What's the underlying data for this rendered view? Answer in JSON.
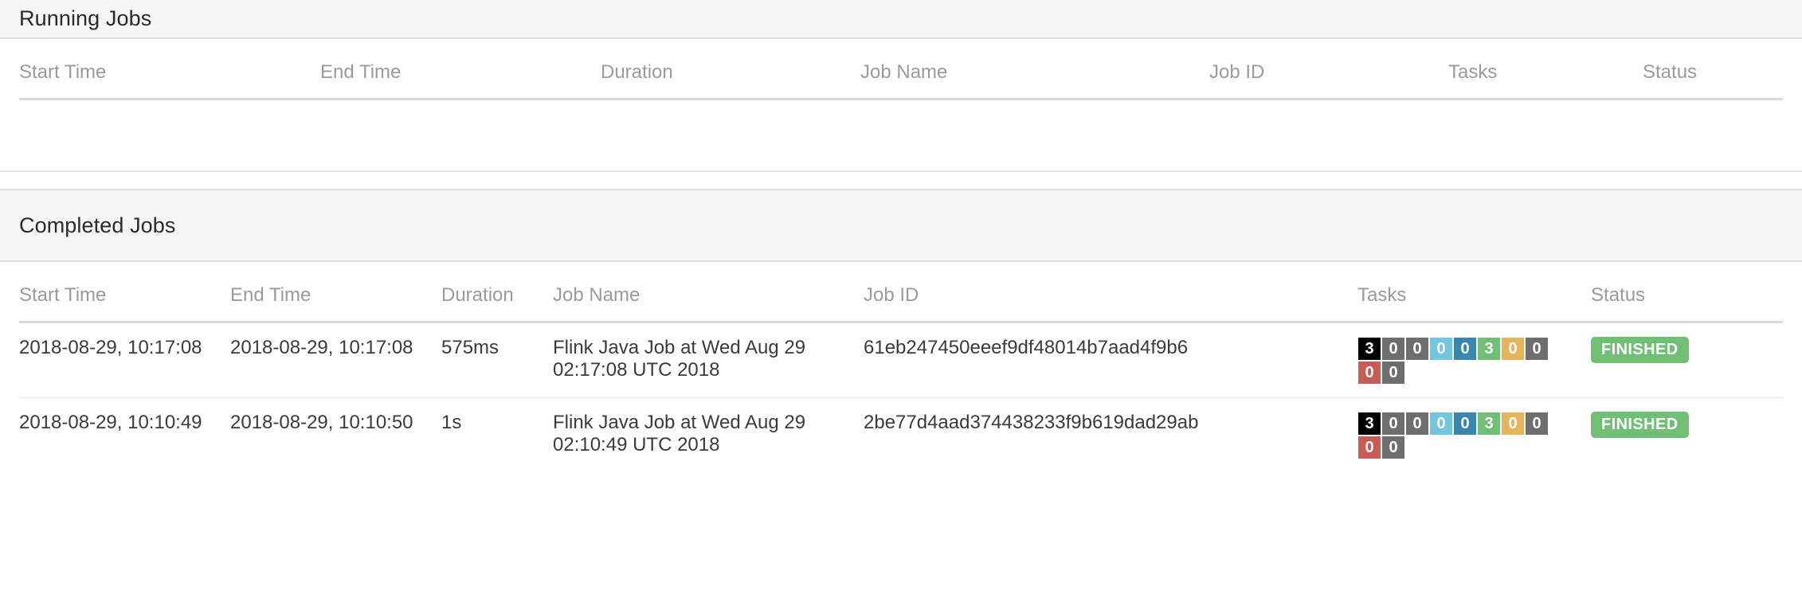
{
  "running": {
    "title": "Running Jobs",
    "columns": [
      "Start Time",
      "End Time",
      "Duration",
      "Job Name",
      "Job ID",
      "Tasks",
      "Status"
    ],
    "rows": []
  },
  "completed": {
    "title": "Completed Jobs",
    "columns": [
      "Start Time",
      "End Time",
      "Duration",
      "Job Name",
      "Job ID",
      "Tasks",
      "Status"
    ],
    "rows": [
      {
        "start_time": "2018-08-29, 10:17:08",
        "end_time": "2018-08-29, 10:17:08",
        "duration": "575ms",
        "job_name": "Flink Java Job at Wed Aug 29 02:17:08 UTC 2018",
        "job_id": "61eb247450eeef9df48014b7aad4f9b6",
        "tasks": [
          {
            "value": "3",
            "color": "#000000",
            "state": "total"
          },
          {
            "value": "0",
            "color": "#6e6e6e",
            "state": "created"
          },
          {
            "value": "0",
            "color": "#6e6e6e",
            "state": "scheduled"
          },
          {
            "value": "0",
            "color": "#73c6e0",
            "state": "deploying"
          },
          {
            "value": "0",
            "color": "#3a87ad",
            "state": "running"
          },
          {
            "value": "3",
            "color": "#71bf75",
            "state": "finished"
          },
          {
            "value": "0",
            "color": "#e5b45d",
            "state": "canceling"
          },
          {
            "value": "0",
            "color": "#6e6e6e",
            "state": "canceled"
          },
          {
            "value": "0",
            "color": "#c85b56",
            "state": "failed"
          },
          {
            "value": "0",
            "color": "#6e6e6e",
            "state": "reconciling"
          }
        ],
        "status": "FINISHED",
        "status_color": "#71bf75"
      },
      {
        "start_time": "2018-08-29, 10:10:49",
        "end_time": "2018-08-29, 10:10:50",
        "duration": "1s",
        "job_name": "Flink Java Job at Wed Aug 29 02:10:49 UTC 2018",
        "job_id": "2be77d4aad374438233f9b619dad29ab",
        "tasks": [
          {
            "value": "3",
            "color": "#000000",
            "state": "total"
          },
          {
            "value": "0",
            "color": "#6e6e6e",
            "state": "created"
          },
          {
            "value": "0",
            "color": "#6e6e6e",
            "state": "scheduled"
          },
          {
            "value": "0",
            "color": "#73c6e0",
            "state": "deploying"
          },
          {
            "value": "0",
            "color": "#3a87ad",
            "state": "running"
          },
          {
            "value": "3",
            "color": "#71bf75",
            "state": "finished"
          },
          {
            "value": "0",
            "color": "#e5b45d",
            "state": "canceling"
          },
          {
            "value": "0",
            "color": "#6e6e6e",
            "state": "canceled"
          },
          {
            "value": "0",
            "color": "#c85b56",
            "state": "failed"
          },
          {
            "value": "0",
            "color": "#6e6e6e",
            "state": "reconciling"
          }
        ],
        "status": "FINISHED",
        "status_color": "#71bf75"
      }
    ]
  }
}
